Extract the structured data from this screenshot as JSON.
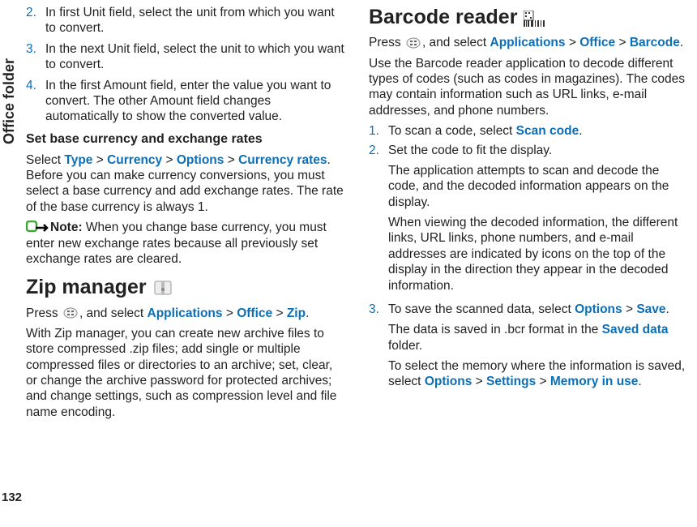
{
  "side_tab": "Office folder",
  "page_number": "132",
  "left": {
    "steps_a": [
      {
        "n": "2.",
        "t": "In first Unit field, select the unit from which you want to convert."
      },
      {
        "n": "3.",
        "t": "In the next Unit field, select the unit to which you want to convert."
      },
      {
        "n": "4.",
        "t": "In the first Amount field, enter the value you want to convert. The other Amount field changes automatically to show the converted value."
      }
    ],
    "subheading": "Set base currency and exchange rates",
    "para1_pre": "Select ",
    "path1": [
      "Type",
      "Currency",
      "Options",
      "Currency rates"
    ],
    "para1_post": ". Before you can make currency conversions, you must select a base currency and add exchange rates. The rate of the base currency is always 1.",
    "note_label": "Note:",
    "note_text": "  When you change base currency, you must enter new exchange rates because all previously set exchange rates are cleared.",
    "zip_heading": "Zip manager",
    "zip_press": "Press ",
    "zip_sel": ", and select ",
    "zip_path": [
      "Applications",
      "Office",
      "Zip"
    ],
    "zip_body": "With Zip manager, you can create new archive files to store compressed .zip files; add single or multiple compressed files or directories to an archive; set, clear, or change the archive password for protected archives; and change settings, such as compression level and file name encoding."
  },
  "right": {
    "heading": "Barcode reader",
    "press": "Press ",
    "sel": ", and select ",
    "path1": [
      "Applications",
      "Office",
      "Barcode"
    ],
    "body1": "Use the Barcode reader application to decode different types of codes (such as codes in magazines). The codes may contain information such as URL links, e-mail addresses, and phone numbers.",
    "steps": [
      {
        "n": "1.",
        "parts": [
          {
            "pre": "To scan a code, select ",
            "kw": "Scan code",
            "post": "."
          }
        ]
      },
      {
        "n": "2.",
        "parts": [
          {
            "plain": "Set the code to fit the display."
          },
          {
            "plain": "The application attempts to scan and decode the code, and the decoded information appears on the display."
          },
          {
            "plain": "When viewing the decoded information, the different links, URL links, phone numbers, and e-mail addresses are indicated by icons on the top of the display in the direction they appear in the decoded information."
          }
        ]
      },
      {
        "n": "3.",
        "parts": [
          {
            "pre": "To save the scanned data, select ",
            "path": [
              "Options",
              "Save"
            ],
            "post": "."
          },
          {
            "mixed_pre": "The data is saved in .bcr format in the ",
            "kw": "Saved data",
            "mixed_post": " folder."
          },
          {
            "pre": "To select the memory where the information is saved, select ",
            "path": [
              "Options",
              "Settings",
              "Memory in use"
            ],
            "post": "."
          }
        ]
      }
    ]
  },
  "sep": " > "
}
